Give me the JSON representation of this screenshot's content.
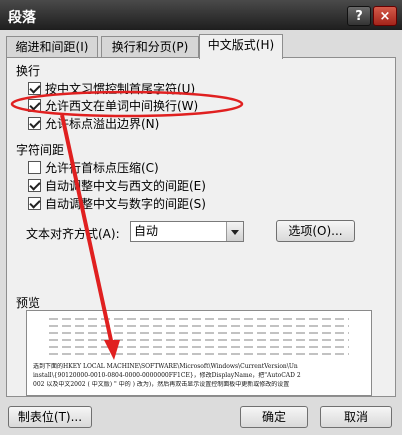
{
  "window": {
    "title": "段落",
    "help_label": "?",
    "close_label": "×"
  },
  "tabs": [
    {
      "label": "缩进和间距(I)",
      "active": false
    },
    {
      "label": "换行和分页(P)",
      "active": false
    },
    {
      "label": "中文版式(H)",
      "active": true
    }
  ],
  "line_break": {
    "group_label": "换行",
    "options": [
      {
        "label": "按中文习惯控制首尾字符(U)",
        "checked": true
      },
      {
        "label": "允许西文在单词中间换行(W)",
        "checked": true
      },
      {
        "label": "允许标点溢出边界(N)",
        "checked": true
      }
    ]
  },
  "char_spacing": {
    "group_label": "字符间距",
    "options": [
      {
        "label": "允许行首标点压缩(C)",
        "checked": false
      },
      {
        "label": "自动调整中文与西文的间距(E)",
        "checked": true
      },
      {
        "label": "自动调整中文与数字的间距(S)",
        "checked": true
      }
    ]
  },
  "text_align": {
    "label": "文本对齐方式(A):",
    "value": "自动",
    "options_button": "选项(O)..."
  },
  "preview": {
    "group_label": "预览",
    "sample_lines": [
      "选到下面的HKEY LOCAL MACHINE\\SOFTWARE\\Microsoft\\Windows\\CurrentVersion\\Un",
      "install\\{90120000-0010-0804-0000-0000000FF1CE}，修改DisplayName，把\"AutoCAD 2",
      "002 以及中文2002 ( 中文版) \" 中的 ) 改为)，然后再双击显示设置控制面板中更新或修改的设置"
    ]
  },
  "footer": {
    "tabs_button": "制表位(T)...",
    "ok_button": "确定",
    "cancel_button": "取消"
  },
  "annotation": {
    "color": "#e02020"
  }
}
